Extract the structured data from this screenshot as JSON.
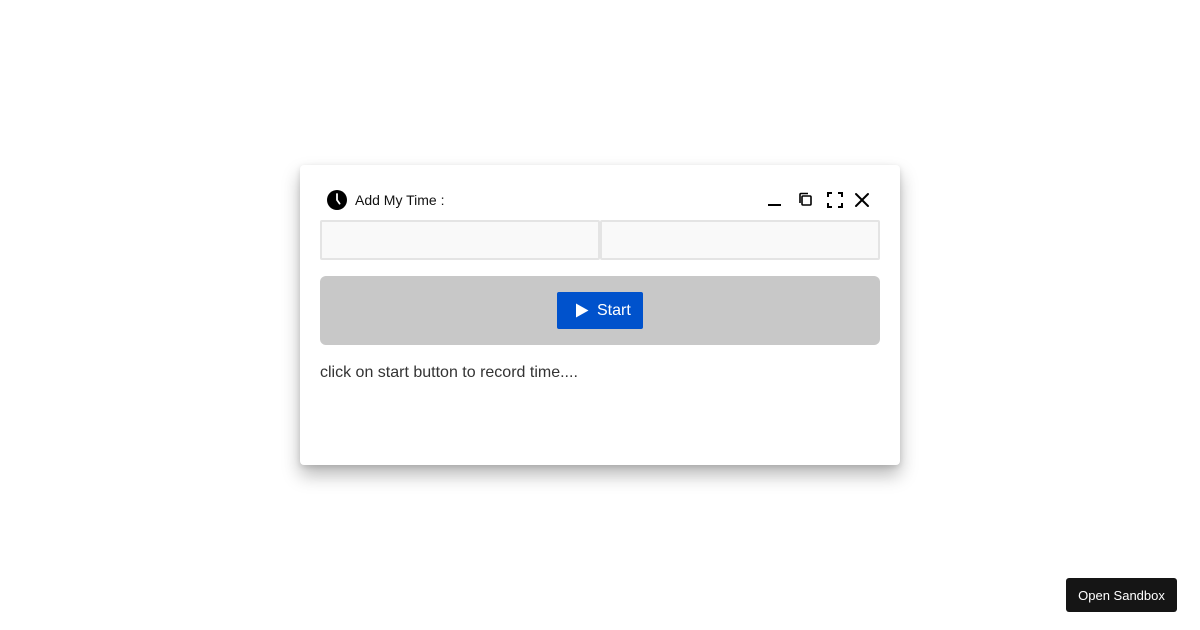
{
  "window": {
    "title": "Add My Time :",
    "icons": {
      "title": "clock-icon",
      "minimize": "minimize-icon",
      "restore": "restore-icon",
      "maximize": "maximize-icon",
      "close": "close-icon"
    },
    "inputs": [
      {
        "value": "",
        "placeholder": ""
      },
      {
        "value": "",
        "placeholder": ""
      }
    ],
    "start_button": {
      "label": "Start",
      "icon": "play-icon",
      "color": "#0052cc"
    },
    "hint_text": "click on start button to record time...."
  },
  "sandbox_button": {
    "label": "Open Sandbox"
  },
  "colors": {
    "accent": "#0052cc",
    "action_bar": "#c8c8c8",
    "sandbox_button": "#151515"
  }
}
